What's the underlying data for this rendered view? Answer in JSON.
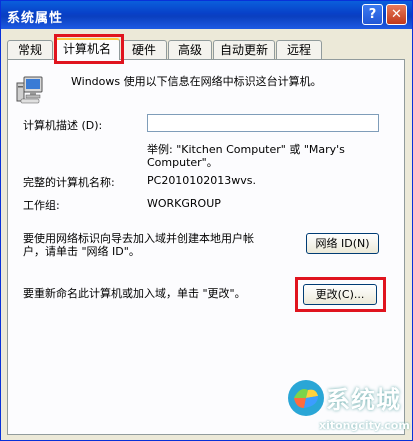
{
  "window": {
    "title": "系统属性",
    "help": "?",
    "close": "✕"
  },
  "tabs": [
    "常规",
    "计算机名",
    "硬件",
    "高级",
    "自动更新",
    "远程"
  ],
  "info_text": "Windows 使用以下信息在网络中标识这台计算机。",
  "description": {
    "label": "计算机描述 (D):",
    "example_line1": "举例: \"Kitchen Computer\" 或 \"Mary's",
    "example_line2": "Computer\"。"
  },
  "full_name": {
    "label": "完整的计算机名称:",
    "value": "PC2010102013wvs."
  },
  "workgroup": {
    "label": "工作组:",
    "value": "WORKGROUP"
  },
  "network_id": {
    "line1": "要使用网络标识向导去加入域并创建本地用户帐",
    "line2": "户，请单击 \"网络 ID\"。",
    "button": "网络 ID(N)"
  },
  "change": {
    "text": "要重新命名此计算机或加入域，单击 \"更改\"。",
    "button": "更改(C)..."
  },
  "watermark": {
    "name": "系统城",
    "url": "xitongcity.com"
  }
}
